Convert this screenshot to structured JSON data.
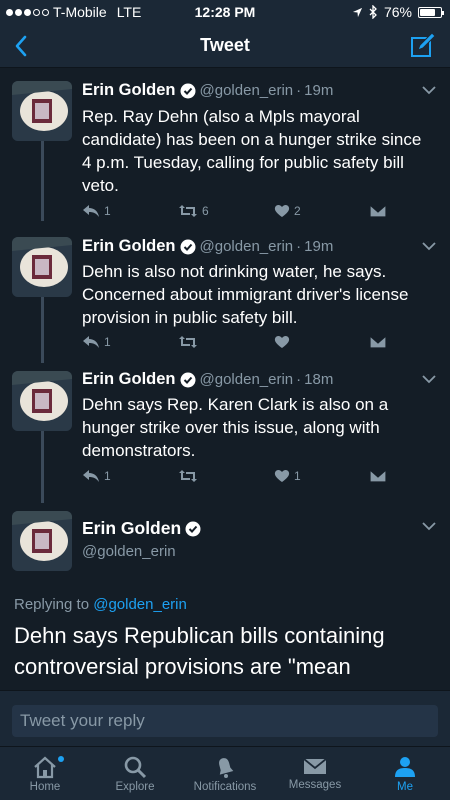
{
  "status_bar": {
    "carrier": "T-Mobile",
    "network": "LTE",
    "time": "12:28 PM",
    "battery": "76%",
    "battery_level": 0.76
  },
  "nav": {
    "title": "Tweet"
  },
  "tweets": [
    {
      "name": "Erin Golden",
      "handle": "@golden_erin",
      "separator": "·",
      "time": "19m",
      "text": "Rep. Ray Dehn (also a Mpls mayoral candidate) has been on a hunger strike since 4 p.m. Tuesday, calling for public safety bill veto.",
      "replies": "1",
      "retweets": "6",
      "likes": "2"
    },
    {
      "name": "Erin Golden",
      "handle": "@golden_erin",
      "separator": "·",
      "time": "19m",
      "text": "Dehn is also not drinking water, he says. Concerned about immigrant driver's license provision in public safety bill.",
      "replies": "1",
      "retweets": "",
      "likes": ""
    },
    {
      "name": "Erin Golden",
      "handle": "@golden_erin",
      "separator": "·",
      "time": "18m",
      "text": "Dehn says Rep. Karen Clark is also on a hunger strike over this issue, along with demonstrators.",
      "replies": "1",
      "retweets": "",
      "likes": "1"
    }
  ],
  "main_tweet": {
    "name": "Erin Golden",
    "handle": "@golden_erin",
    "replying_prefix": "Replying to",
    "replying_to": "@golden_erin",
    "text": "Dehn says Republican bills containing controversial provisions are \"mean"
  },
  "reply": {
    "placeholder": "Tweet your reply"
  },
  "tabs": [
    {
      "label": "Home",
      "icon": "home-icon"
    },
    {
      "label": "Explore",
      "icon": "search-icon"
    },
    {
      "label": "Notifications",
      "icon": "bell-icon"
    },
    {
      "label": "Messages",
      "icon": "envelope-icon"
    },
    {
      "label": "Me",
      "icon": "person-icon"
    }
  ],
  "colors": {
    "background": "#141d26",
    "bar": "#1b2836",
    "accent": "#1da1f2",
    "secondary_text": "#8899a6"
  }
}
